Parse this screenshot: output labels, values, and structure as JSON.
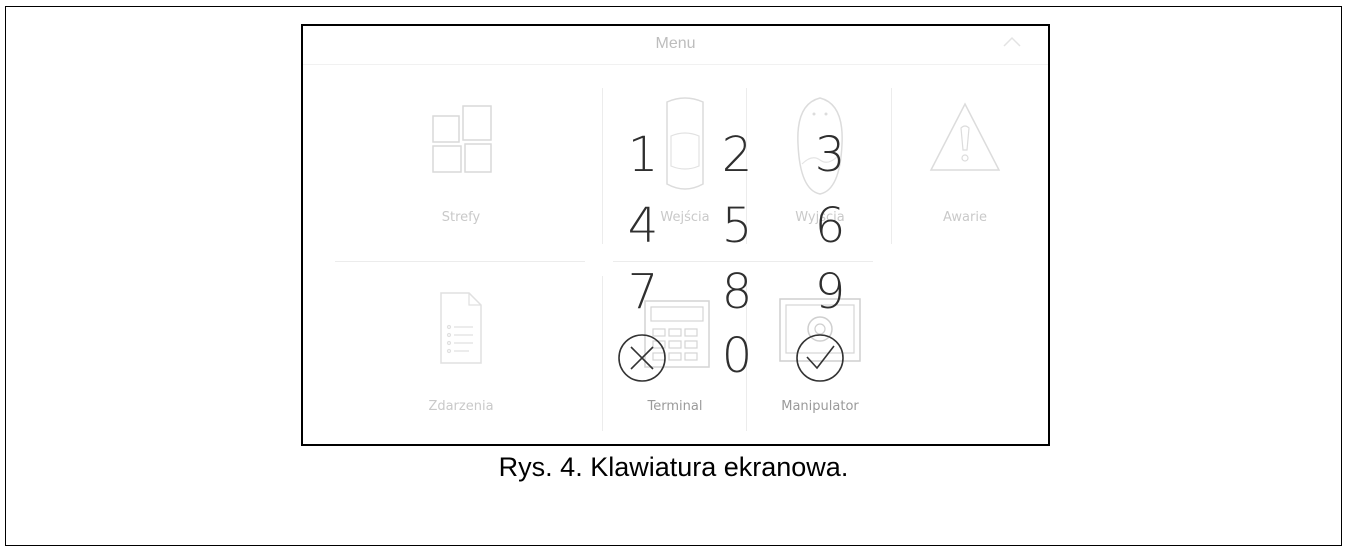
{
  "header": {
    "title": "Menu",
    "collapse_icon": "chevron-up-icon"
  },
  "menu_tiles": [
    {
      "label": "Strefy",
      "icon": "zones-icon"
    },
    {
      "label": "Wejścia",
      "icon": "detector-icon"
    },
    {
      "label": "Wyjścia",
      "icon": "remote-icon"
    },
    {
      "label": "Awarie",
      "icon": "warning-icon"
    },
    {
      "label": "Zdarzenia",
      "icon": "document-icon"
    },
    {
      "label": "Terminal",
      "icon": "keypad-device-icon"
    },
    {
      "label": "Manipulator",
      "icon": "settings-screen-icon"
    }
  ],
  "keypad": {
    "keys": [
      "1",
      "2",
      "3",
      "4",
      "5",
      "6",
      "7",
      "8",
      "9",
      "0"
    ],
    "cancel_icon": "cancel-circle-icon",
    "confirm_icon": "confirm-circle-icon"
  },
  "caption": "Rys. 4. Klawiatura ekranowa."
}
